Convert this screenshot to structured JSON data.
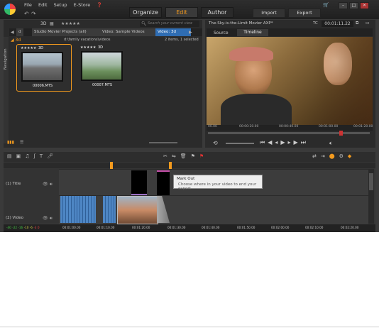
{
  "menu": {
    "file": "File",
    "edit": "Edit",
    "setup": "Setup",
    "estore": "E-Store"
  },
  "modes": {
    "organize": "Organize",
    "edit": "Edit",
    "author": "Author"
  },
  "actions": {
    "import": "Import",
    "export": "Export"
  },
  "library": {
    "view_3d": "3D",
    "rating": "★★★★★",
    "search_placeholder": "Search your current view",
    "tabs": [
      "d",
      "Studio Movier Projects (all)",
      "Video: Sample Videos",
      "Video: 3d"
    ],
    "folder": "3d",
    "path": "d:\\family vacations\\videos",
    "count": "2 items, 1 selected",
    "items": [
      {
        "name": "00006.MTS",
        "rating": "★★★★★",
        "badge": "3D"
      },
      {
        "name": "00007.MTS",
        "rating": "★★★★★",
        "badge": "3D"
      }
    ],
    "nav_label": "Navigation"
  },
  "preview": {
    "title": "The-Sky-is-the-Limit Movier AXP*",
    "tc_label": "TC",
    "timecode": "00:01:11.22",
    "tabs": [
      "Source",
      "Timeline"
    ],
    "ruler": [
      "00.00",
      "00:00:20.00",
      "00:00:40.00",
      "00:01:00.00",
      "00:01:20.00"
    ]
  },
  "timeline": {
    "tracks": [
      {
        "label": "(1) Title"
      },
      {
        "label": "(2) Video"
      }
    ],
    "ruler": [
      "00:01:00.00",
      "00:01:10.00",
      "00:01:20.00",
      "00:01:30.00",
      "00:01:40.00",
      "00:01:50.00",
      "00:02:00.00",
      "00:02:10.00",
      "00:02:20.00"
    ],
    "meter": [
      "-40",
      "-22",
      "-16",
      "-10",
      "-6",
      "-3",
      "0"
    ],
    "tooltip": {
      "title": "Mark Out",
      "text": "Choose where in your video to end your export"
    }
  },
  "colors": {
    "accent": "#f39a1e",
    "selected_tab": "#2f6db3"
  }
}
